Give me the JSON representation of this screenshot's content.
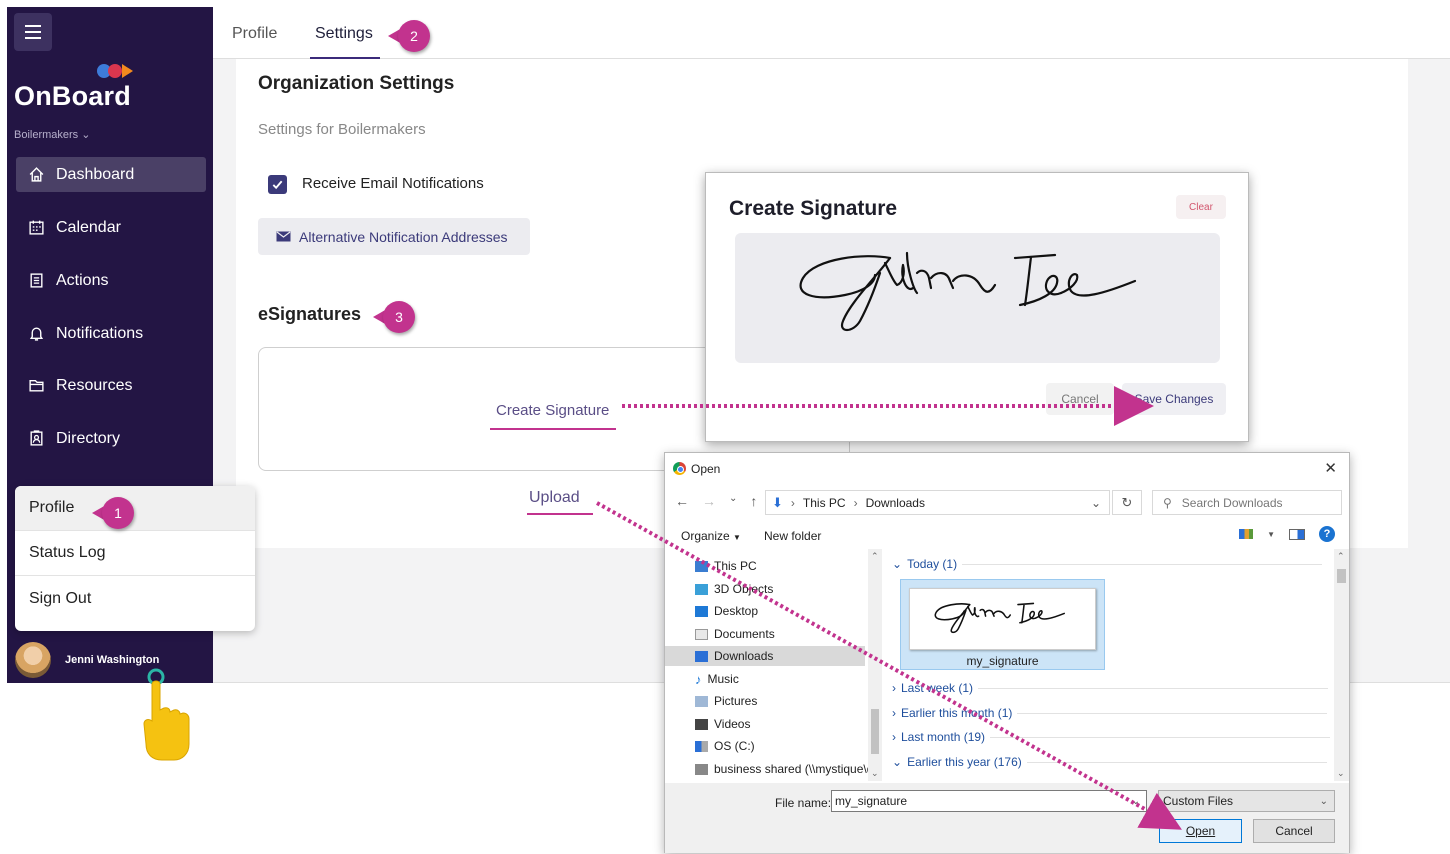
{
  "sidebar": {
    "brand": "OnBoard",
    "org_switcher": "Boilermakers",
    "nav": [
      {
        "label": "Dashboard",
        "icon": "home-icon",
        "active": true
      },
      {
        "label": "Calendar",
        "icon": "calendar-icon",
        "active": false
      },
      {
        "label": "Actions",
        "icon": "clipboard-icon",
        "active": false
      },
      {
        "label": "Notifications",
        "icon": "bell-icon",
        "active": false
      },
      {
        "label": "Resources",
        "icon": "folder-icon",
        "active": false
      },
      {
        "label": "Directory",
        "icon": "contact-card-icon",
        "active": false
      }
    ],
    "user_name": "Jenni Washington"
  },
  "profile_menu": {
    "items": [
      "Profile",
      "Status Log",
      "Sign Out"
    ],
    "selected": "Profile"
  },
  "tabs": {
    "items": [
      "Profile",
      "Settings"
    ],
    "active": "Settings"
  },
  "settings": {
    "title": "Organization Settings",
    "subtitle": "Settings for Boilermakers",
    "email_notifications_label": "Receive Email Notifications",
    "email_notifications_checked": true,
    "alt_addresses_button": "Alternative Notification Addresses",
    "esignatures_title": "eSignatures",
    "create_signature_link": "Create Signature",
    "upload_link": "Upload"
  },
  "signature_modal": {
    "title": "Create Signature",
    "clear": "Clear",
    "cancel": "Cancel",
    "save": "Save Changes"
  },
  "open_dialog": {
    "title": "Open",
    "breadcrumb": [
      "This PC",
      "Downloads"
    ],
    "search_placeholder": "Search Downloads",
    "organize": "Organize",
    "new_folder": "New folder",
    "tree": [
      "This PC",
      "3D Objects",
      "Desktop",
      "Documents",
      "Downloads",
      "Music",
      "Pictures",
      "Videos",
      "OS (C:)",
      "business shared (\\\\mystique\\da"
    ],
    "tree_selected": "Downloads",
    "groups": [
      "Today (1)",
      "Last week (1)",
      "Earlier this month (1)",
      "Last month (19)",
      "Earlier this year (176)"
    ],
    "file_name": "my_signature",
    "file_name_label": "File name:",
    "file_name_value": "my_signature",
    "filter": "Custom Files",
    "open_button": "Open",
    "cancel_button": "Cancel"
  },
  "callouts": [
    "1",
    "2",
    "3"
  ],
  "colors": {
    "sidebar_bg": "#231544",
    "accent_magenta": "#c2338e",
    "primary_indigo": "#3b3a7a"
  }
}
